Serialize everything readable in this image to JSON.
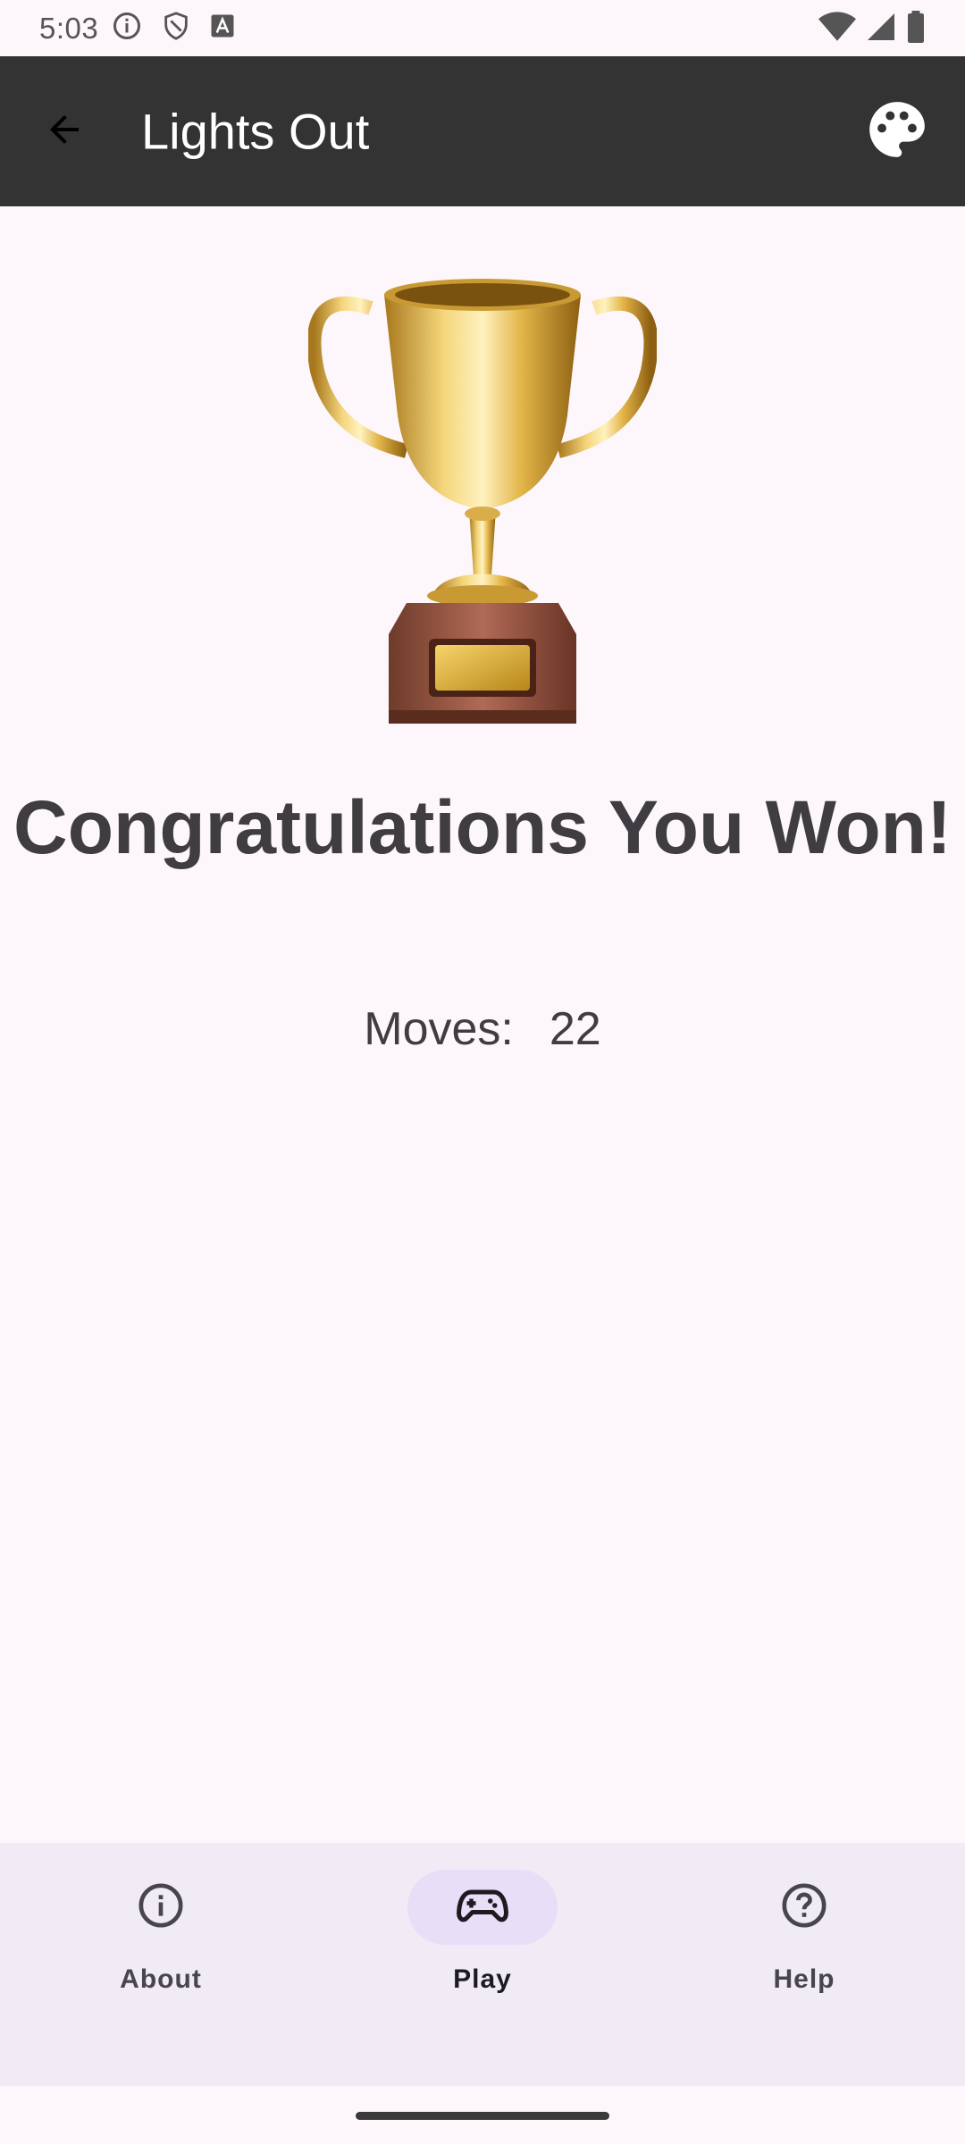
{
  "status_bar": {
    "time": "5:03",
    "left_icons": [
      "info-icon",
      "shield-icon",
      "text-a-icon"
    ],
    "right_icons": [
      "wifi-icon",
      "signal-icon",
      "battery-icon"
    ]
  },
  "app_bar": {
    "title": "Lights Out",
    "back_icon": "arrow-back-icon",
    "action_icon": "palette-icon",
    "background": "#333333"
  },
  "main": {
    "trophy_icon": "trophy-icon",
    "headline": "Congratulations You Won!",
    "moves_label": "Moves:",
    "moves_value": "22"
  },
  "bottom_nav": {
    "items": [
      {
        "label": "About",
        "icon": "info-outline-icon",
        "active": false
      },
      {
        "label": "Play",
        "icon": "gamepad-icon",
        "active": true
      },
      {
        "label": "Help",
        "icon": "help-outline-icon",
        "active": false
      }
    ],
    "active_pill_color": "#e8def8",
    "background": "#f1ebf5"
  }
}
